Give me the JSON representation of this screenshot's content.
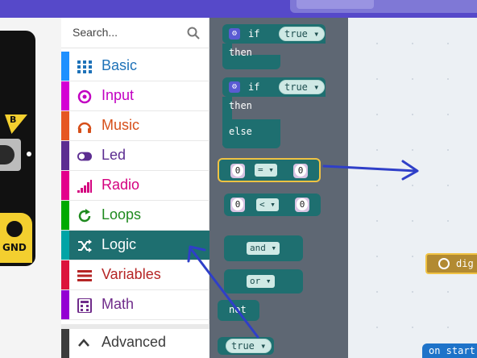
{
  "search": {
    "placeholder": "Search..."
  },
  "categories": [
    {
      "label": "Basic",
      "color": "#1e90ff",
      "text_color": "#1e72b8",
      "icon": "grid-icon"
    },
    {
      "label": "Input",
      "color": "#d400d4",
      "text_color": "#c200c2",
      "icon": "target-icon"
    },
    {
      "label": "Music",
      "color": "#e65722",
      "text_color": "#d64f1a",
      "icon": "headphones-icon"
    },
    {
      "label": "Led",
      "color": "#5c2d91",
      "text_color": "#5c2d91",
      "icon": "toggle-icon"
    },
    {
      "label": "Radio",
      "color": "#e3008c",
      "text_color": "#d4007f",
      "icon": "signal-icon"
    },
    {
      "label": "Loops",
      "color": "#00aa00",
      "text_color": "#1f8a1f",
      "icon": "refresh-icon"
    },
    {
      "label": "Logic",
      "color": "#00a4a6",
      "text_color": "#ffffff",
      "icon": "shuffle-icon"
    },
    {
      "label": "Variables",
      "color": "#dc143c",
      "text_color": "#b52525",
      "icon": "list-icon"
    },
    {
      "label": "Math",
      "color": "#9400d3",
      "text_color": "#6f2b8a",
      "icon": "calculator-icon"
    }
  ],
  "advanced": {
    "label": "Advanced",
    "icon": "chevron-up-icon"
  },
  "board": {
    "button_label": "B",
    "pin_label": "GND"
  },
  "blocks": {
    "if1": {
      "if": "if",
      "cond": "true",
      "then": "then"
    },
    "if2": {
      "if": "if",
      "cond": "true",
      "then": "then",
      "else": "else"
    },
    "compare_eq": {
      "left": "0",
      "op": "=",
      "right": "0"
    },
    "compare_lt": {
      "left": "0",
      "op": "<",
      "right": "0"
    },
    "and": "and",
    "or": "or",
    "not": "not",
    "true": "true"
  },
  "workspace": {
    "on_start": "on start",
    "digital": "dig"
  },
  "colors": {
    "topbar": "#5649c9",
    "logic": "#1e6f70",
    "flyout_bg": "#5e6773",
    "arrow": "#2f3fc8"
  }
}
